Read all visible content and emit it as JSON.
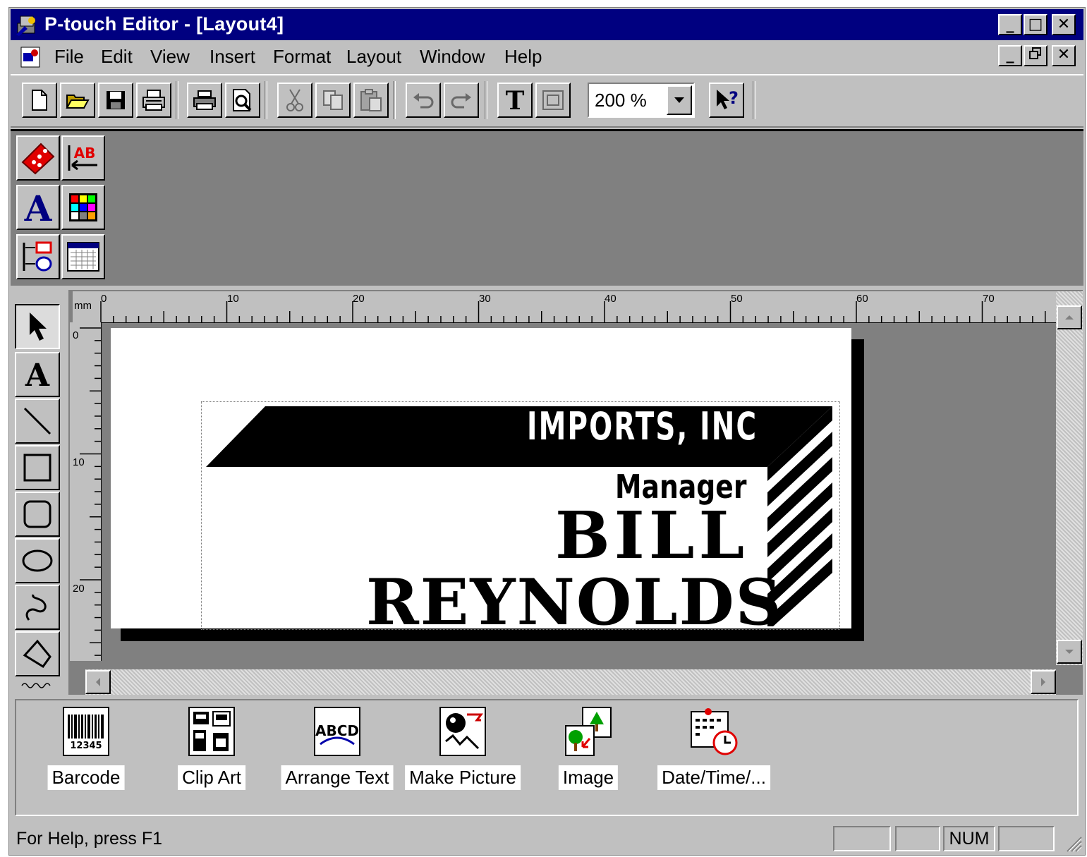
{
  "window": {
    "title": "P-touch Editor - [Layout4]",
    "caption_minimize": "_",
    "caption_maximize": "□",
    "caption_close": "✕"
  },
  "menu": {
    "items": [
      {
        "label": "File"
      },
      {
        "label": "Edit"
      },
      {
        "label": "View"
      },
      {
        "label": "Insert"
      },
      {
        "label": "Format"
      },
      {
        "label": "Layout"
      },
      {
        "label": "Window"
      },
      {
        "label": "Help"
      }
    ]
  },
  "toolbar": {
    "zoom_value": "200 %",
    "buttons": [
      "new-icon",
      "open-icon",
      "save-icon",
      "print-setup-icon",
      "print-icon",
      "print-preview-icon",
      "cut-icon",
      "copy-icon",
      "paste-icon",
      "undo-icon",
      "redo-icon",
      "text-icon",
      "frame-icon",
      "context-help-icon"
    ]
  },
  "ruler": {
    "unit": "mm",
    "h_labels": [
      "0",
      "10",
      "20",
      "30",
      "40",
      "50",
      "60",
      "70"
    ],
    "v_labels": [
      "0",
      "10",
      "20"
    ]
  },
  "label": {
    "company": "IMPORTS, INC",
    "role": "Manager",
    "first_name": "BILL",
    "last_name": "REYNOLDS"
  },
  "wizards": {
    "items": [
      {
        "label": "Barcode",
        "icon": "barcode-icon",
        "icon_text": "12345"
      },
      {
        "label": "Clip Art",
        "icon": "clip-art-icon"
      },
      {
        "label": "Arrange Text",
        "icon": "arrange-text-icon",
        "icon_text": "ABCD"
      },
      {
        "label": "Make Picture",
        "icon": "make-picture-icon"
      },
      {
        "label": "Image",
        "icon": "image-icon"
      },
      {
        "label": "Date/Time/...",
        "icon": "date-time-icon"
      }
    ]
  },
  "status": {
    "help_text": "For Help, press F1",
    "num_indicator": "NUM"
  },
  "colors": {
    "titlebar": "#000080",
    "face": "#c0c0c0",
    "workspace": "#808080"
  }
}
